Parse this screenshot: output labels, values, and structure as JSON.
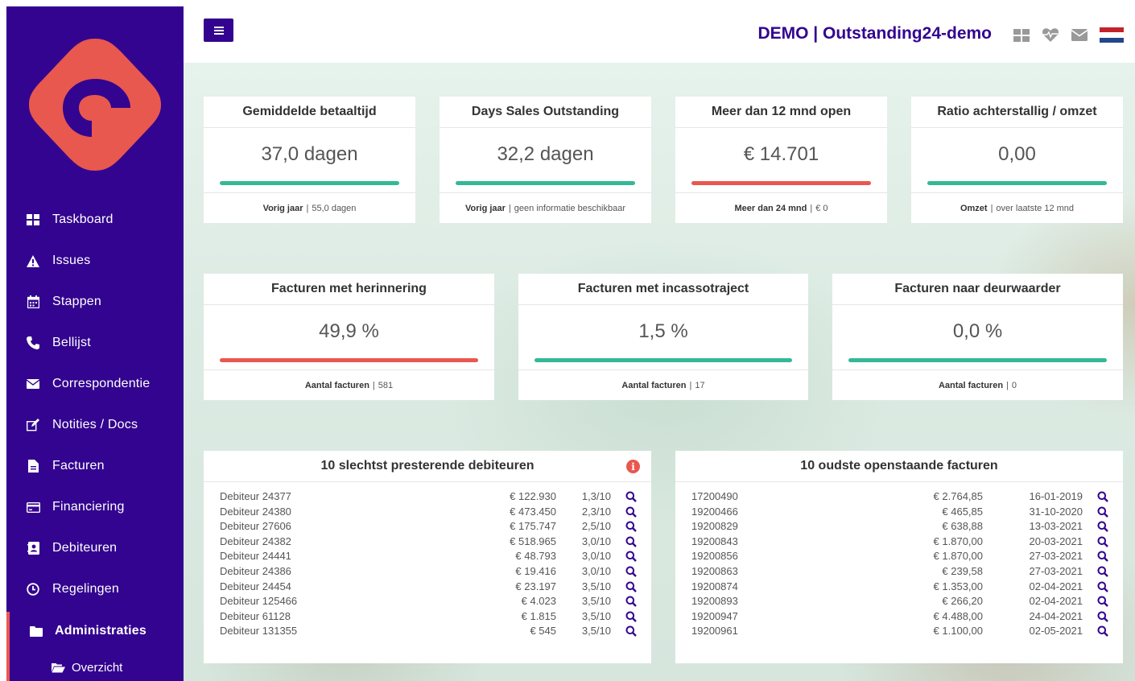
{
  "app": {
    "title": "DEMO | Outstanding24-demo"
  },
  "sidebar": {
    "items": [
      {
        "label": "Taskboard",
        "icon": "grid-icon"
      },
      {
        "label": "Issues",
        "icon": "warning-icon"
      },
      {
        "label": "Stappen",
        "icon": "calendar-icon"
      },
      {
        "label": "Bellijst",
        "icon": "phone-icon"
      },
      {
        "label": "Correspondentie",
        "icon": "envelope-icon"
      },
      {
        "label": "Notities / Docs",
        "icon": "edit-icon"
      },
      {
        "label": "Facturen",
        "icon": "file-icon"
      },
      {
        "label": "Financiering",
        "icon": "credit-card-icon"
      },
      {
        "label": "Debiteuren",
        "icon": "contact-book-icon"
      },
      {
        "label": "Regelingen",
        "icon": "clock-icon"
      },
      {
        "label": "Administraties",
        "icon": "folder-icon"
      }
    ],
    "sub_item": {
      "label": "Overzicht",
      "icon": "folder-open-icon"
    }
  },
  "colors": {
    "brand": "#33048f",
    "good": "#34b896",
    "bad": "#e8584f"
  },
  "kpis_top": [
    {
      "title": "Gemiddelde betaaltijd",
      "value": "37,0 dagen",
      "status": "good",
      "foot_label": "Vorig jaar",
      "foot_value": "55,0 dagen"
    },
    {
      "title": "Days Sales Outstanding",
      "value": "32,2 dagen",
      "status": "good",
      "foot_label": "Vorig jaar",
      "foot_value": "geen informatie beschikbaar"
    },
    {
      "title": "Meer dan 12 mnd open",
      "value": "€ 14.701",
      "status": "bad",
      "foot_label": "Meer dan 24 mnd",
      "foot_value": "€ 0"
    },
    {
      "title": "Ratio achterstallig / omzet",
      "value": "0,00",
      "status": "good",
      "foot_label": "Omzet",
      "foot_value": "over laatste 12 mnd"
    }
  ],
  "kpis_mid": [
    {
      "title": "Facturen met herinnering",
      "value": "49,9 %",
      "status": "bad",
      "foot_label": "Aantal facturen",
      "foot_value": "581"
    },
    {
      "title": "Facturen met incassotraject",
      "value": "1,5 %",
      "status": "good",
      "foot_label": "Aantal facturen",
      "foot_value": "17"
    },
    {
      "title": "Facturen naar deurwaarder",
      "value": "0,0 %",
      "status": "good",
      "foot_label": "Aantal facturen",
      "foot_value": "0"
    }
  ],
  "worst_debtors": {
    "title": "10 slechtst presterende debiteuren",
    "rows": [
      {
        "name": "Debiteur 24377",
        "amount": "€ 122.930",
        "score": "1,3/10"
      },
      {
        "name": "Debiteur 24380",
        "amount": "€ 473.450",
        "score": "2,3/10"
      },
      {
        "name": "Debiteur 27606",
        "amount": "€ 175.747",
        "score": "2,5/10"
      },
      {
        "name": "Debiteur 24382",
        "amount": "€ 518.965",
        "score": "3,0/10"
      },
      {
        "name": "Debiteur 24441",
        "amount": "€ 48.793",
        "score": "3,0/10"
      },
      {
        "name": "Debiteur 24386",
        "amount": "€ 19.416",
        "score": "3,0/10"
      },
      {
        "name": "Debiteur 24454",
        "amount": "€ 23.197",
        "score": "3,5/10"
      },
      {
        "name": "Debiteur 125466",
        "amount": "€ 4.023",
        "score": "3,5/10"
      },
      {
        "name": "Debiteur 61128",
        "amount": "€ 1.815",
        "score": "3,5/10"
      },
      {
        "name": "Debiteur 131355",
        "amount": "€ 545",
        "score": "3,5/10"
      }
    ]
  },
  "oldest_invoices": {
    "title": "10 oudste openstaande facturen",
    "rows": [
      {
        "number": "17200490",
        "amount": "€ 2.764,85",
        "date": "16-01-2019"
      },
      {
        "number": "19200466",
        "amount": "€ 465,85",
        "date": "31-10-2020"
      },
      {
        "number": "19200829",
        "amount": "€ 638,88",
        "date": "13-03-2021"
      },
      {
        "number": "19200843",
        "amount": "€ 1.870,00",
        "date": "20-03-2021"
      },
      {
        "number": "19200856",
        "amount": "€ 1.870,00",
        "date": "27-03-2021"
      },
      {
        "number": "19200863",
        "amount": "€ 239,58",
        "date": "27-03-2021"
      },
      {
        "number": "19200874",
        "amount": "€ 1.353,00",
        "date": "02-04-2021"
      },
      {
        "number": "19200893",
        "amount": "€ 266,20",
        "date": "02-04-2021"
      },
      {
        "number": "19200947",
        "amount": "€ 4.488,00",
        "date": "24-04-2021"
      },
      {
        "number": "19200961",
        "amount": "€ 1.100,00",
        "date": "02-05-2021"
      }
    ]
  }
}
